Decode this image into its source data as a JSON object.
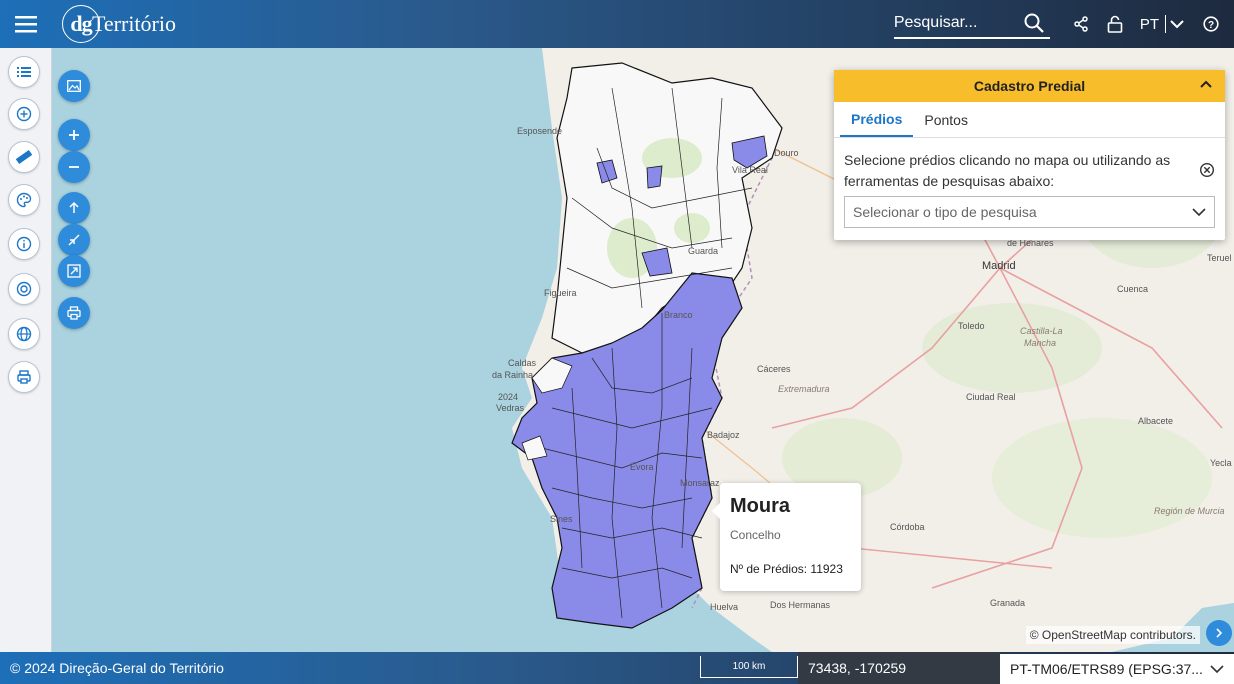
{
  "header": {
    "menu_icon": "hamburger-icon",
    "logo_mark": "dg",
    "logo_text": "Território",
    "search_placeholder": "Pesquisar...",
    "lang": "PT"
  },
  "left_toolbar": [
    {
      "name": "layers-list",
      "icon": "list-icon"
    },
    {
      "name": "add-layer",
      "icon": "plus-circle-icon"
    },
    {
      "name": "measure",
      "icon": "ruler-icon"
    },
    {
      "name": "style",
      "icon": "palette-icon"
    },
    {
      "name": "info",
      "icon": "info-icon"
    },
    {
      "name": "location",
      "icon": "target-icon"
    },
    {
      "name": "basemap",
      "icon": "globe-icon"
    },
    {
      "name": "print",
      "icon": "print-icon"
    }
  ],
  "map": {
    "labels": {
      "esposende": "Esposende",
      "vila_real": "Vila Real",
      "douro": "Douro",
      "guarda": "Guarda",
      "branco": "Branco",
      "figueira": "Figueira",
      "caldas": "Caldas",
      "da_rainha": "da Rainha",
      "oeiras": "2024",
      "vedras": "Vedras",
      "vora": "Évora",
      "monsaraz": "Monsaraz",
      "badajoz": "Badajoz",
      "sines": "Sines",
      "madrid": "Madrid",
      "caceres": "Cáceres",
      "extremadura": "Extremadura",
      "toledo": "Toledo",
      "castilla": "Castilla-La",
      "mancha": "Mancha",
      "ciudad_real": "Ciudad Real",
      "albacete": "Albacete",
      "cuenca": "Cuenca",
      "cordoba": "Córdoba",
      "granada": "Granada",
      "huelva": "Huelva",
      "dos_hermanas": "Dos Hermanas",
      "murcia": "Región de Murcia",
      "yecla": "Yecla",
      "henares": "de Henares",
      "teruel": "Teruel"
    }
  },
  "tooltip": {
    "title": "Moura",
    "subtitle": "Concelho",
    "count": "Nº de Prédios: 11923"
  },
  "panel": {
    "title": "Cadastro Predial",
    "tabs": [
      "Prédios",
      "Pontos"
    ],
    "instructions": "Selecione prédios clicando no mapa ou utilizando as ferramentas de pesquisas abaixo:",
    "select_placeholder": "Selecionar o tipo de pesquisa"
  },
  "attribution": "© OpenStreetMap contributors.",
  "footer": {
    "copyright": "© 2024 Direção-Geral do Território",
    "scale": "100 km",
    "coords": "73438, -170259",
    "projection": "PT-TM06/ETRS89 (EPSG:37..."
  },
  "colors": {
    "header": "#1d6fb8",
    "accent": "#2e8cdb",
    "panel_header": "#f7bd2b",
    "concelho_fill": "#8a8ae8"
  }
}
